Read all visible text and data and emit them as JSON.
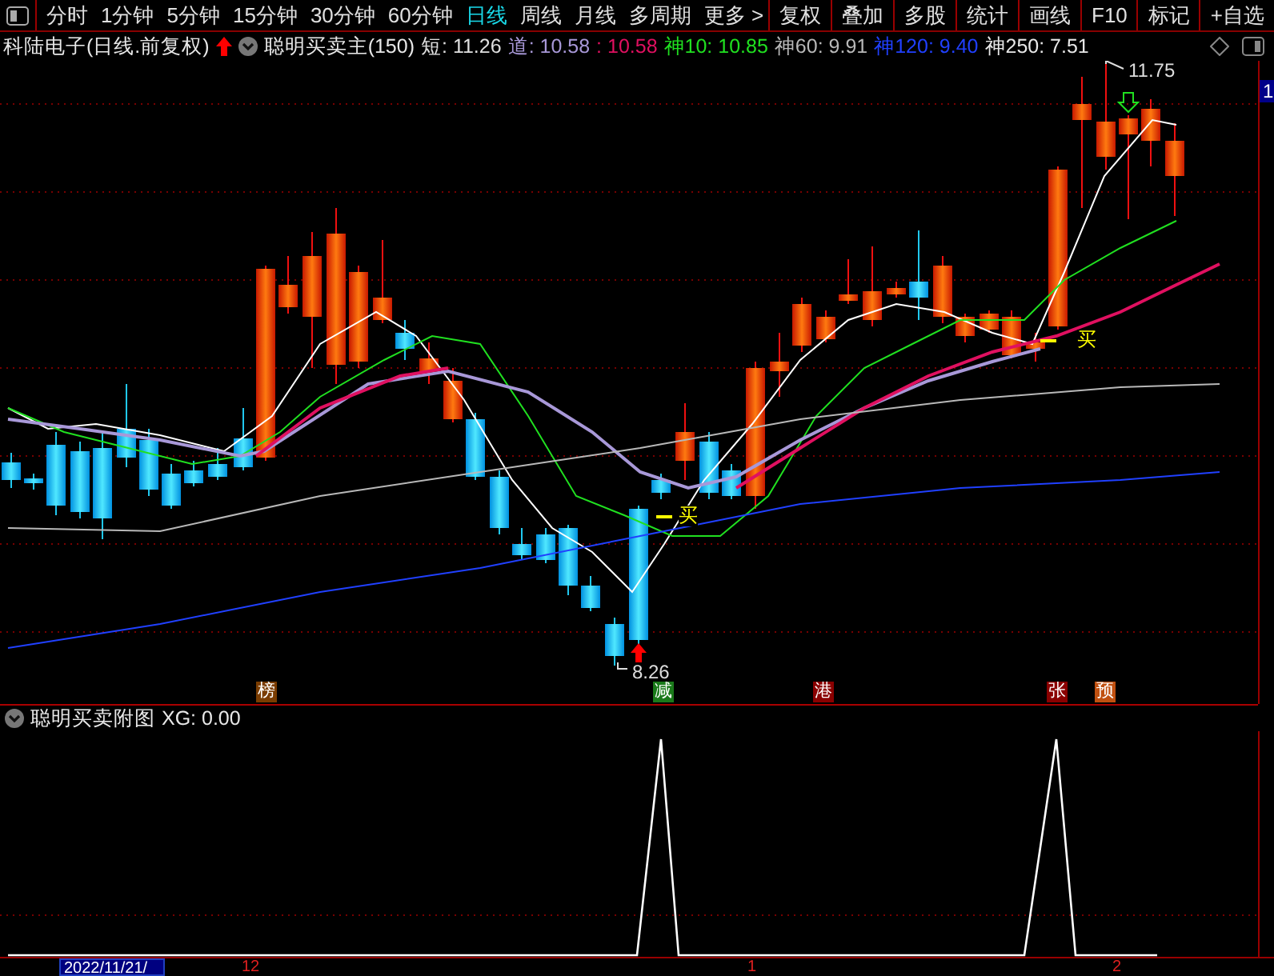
{
  "toolbar": {
    "tabs": [
      {
        "label": "分时",
        "selected": false
      },
      {
        "label": "1分钟",
        "selected": false
      },
      {
        "label": "5分钟",
        "selected": false
      },
      {
        "label": "15分钟",
        "selected": false
      },
      {
        "label": "30分钟",
        "selected": false
      },
      {
        "label": "60分钟",
        "selected": false
      },
      {
        "label": "日线",
        "selected": true
      },
      {
        "label": "周线",
        "selected": false
      },
      {
        "label": "月线",
        "selected": false
      },
      {
        "label": "多周期",
        "selected": false
      }
    ],
    "more": "更多 >",
    "buttons": [
      "复权",
      "叠加",
      "多股",
      "统计",
      "画线",
      "F10",
      "标记",
      "+自选"
    ]
  },
  "main_chart": {
    "title": "科陆电子(日线.前复权)",
    "indicator": "聪明买卖主(150)",
    "values": [
      {
        "label": "短: 11.26",
        "color": "#e0e0e0"
      },
      {
        "label": "道: 10.58",
        "color": "#a898d8"
      },
      {
        "label": ": 10.58",
        "color": "#e01060"
      },
      {
        "label": "神10: 10.85",
        "color": "#20e020"
      },
      {
        "label": "神60: 9.91",
        "color": "#b8b8b8"
      },
      {
        "label": "神120: 9.40",
        "color": "#2040ff"
      },
      {
        "label": "神250: 7.51",
        "color": "#e8e8e8"
      }
    ],
    "high_label": "11.75",
    "low_label": "8.26",
    "price_tag": "1",
    "buy_signals": [
      "买",
      "买"
    ],
    "badges": [
      {
        "text": "榜",
        "color": "#7a3c00"
      },
      {
        "text": "减",
        "color": "#1a7a1a"
      },
      {
        "text": "港",
        "color": "#8a0000"
      },
      {
        "text": "张",
        "color": "#8a0000"
      },
      {
        "text": "预",
        "color": "#c05010"
      }
    ]
  },
  "sub_chart": {
    "title": "聪明买卖附图",
    "reading": "XG: 0.00"
  },
  "time_axis": {
    "cursor_date": "2022/11/21/",
    "labels": [
      "12",
      "1",
      "2"
    ]
  }
}
